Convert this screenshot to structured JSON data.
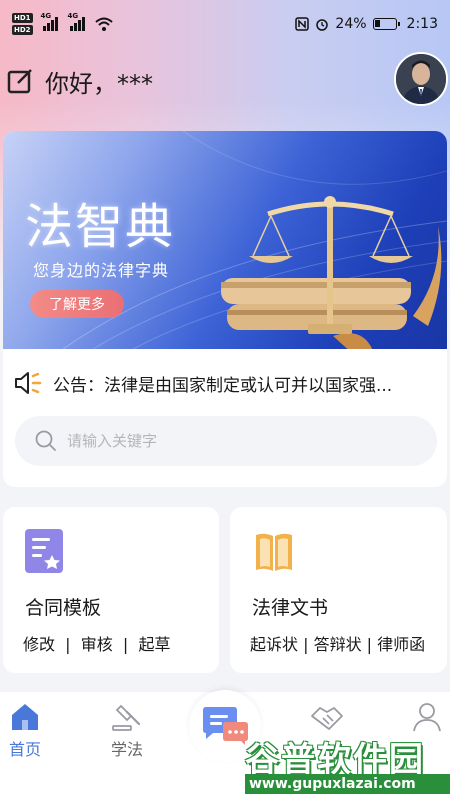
{
  "status_bar": {
    "hd1": "HD1",
    "hd2": "HD2",
    "net1": "4G",
    "net2": "4G",
    "battery": "24%",
    "time": "2:13"
  },
  "header": {
    "greeting": "你好，***"
  },
  "banner": {
    "title": "法智典",
    "subtitle": "您身边的法律字典",
    "button": "了解更多"
  },
  "notice": {
    "text": "公告：法律是由国家制定或认可并以国家强..."
  },
  "search": {
    "placeholder": "请输入关键字"
  },
  "features": [
    {
      "title": "合同模板",
      "links": "修改  |  审核  |  起草"
    },
    {
      "title": "法律文书",
      "links": "起诉状 | 答辩状 | 律师函"
    }
  ],
  "nav": {
    "items": [
      {
        "label": "首页",
        "active": true
      },
      {
        "label": "学法",
        "active": false
      },
      {
        "label": "",
        "active": false
      },
      {
        "label": "",
        "active": false
      },
      {
        "label": "",
        "active": false
      }
    ]
  },
  "watermark": {
    "main": "谷普软件园",
    "url": "www.gupuxlazai.com"
  },
  "colors": {
    "accent": "#4a78d8",
    "banner_button": "#ea6f74",
    "icon_purple": "#8f86e8",
    "icon_orange": "#f3b14c"
  }
}
